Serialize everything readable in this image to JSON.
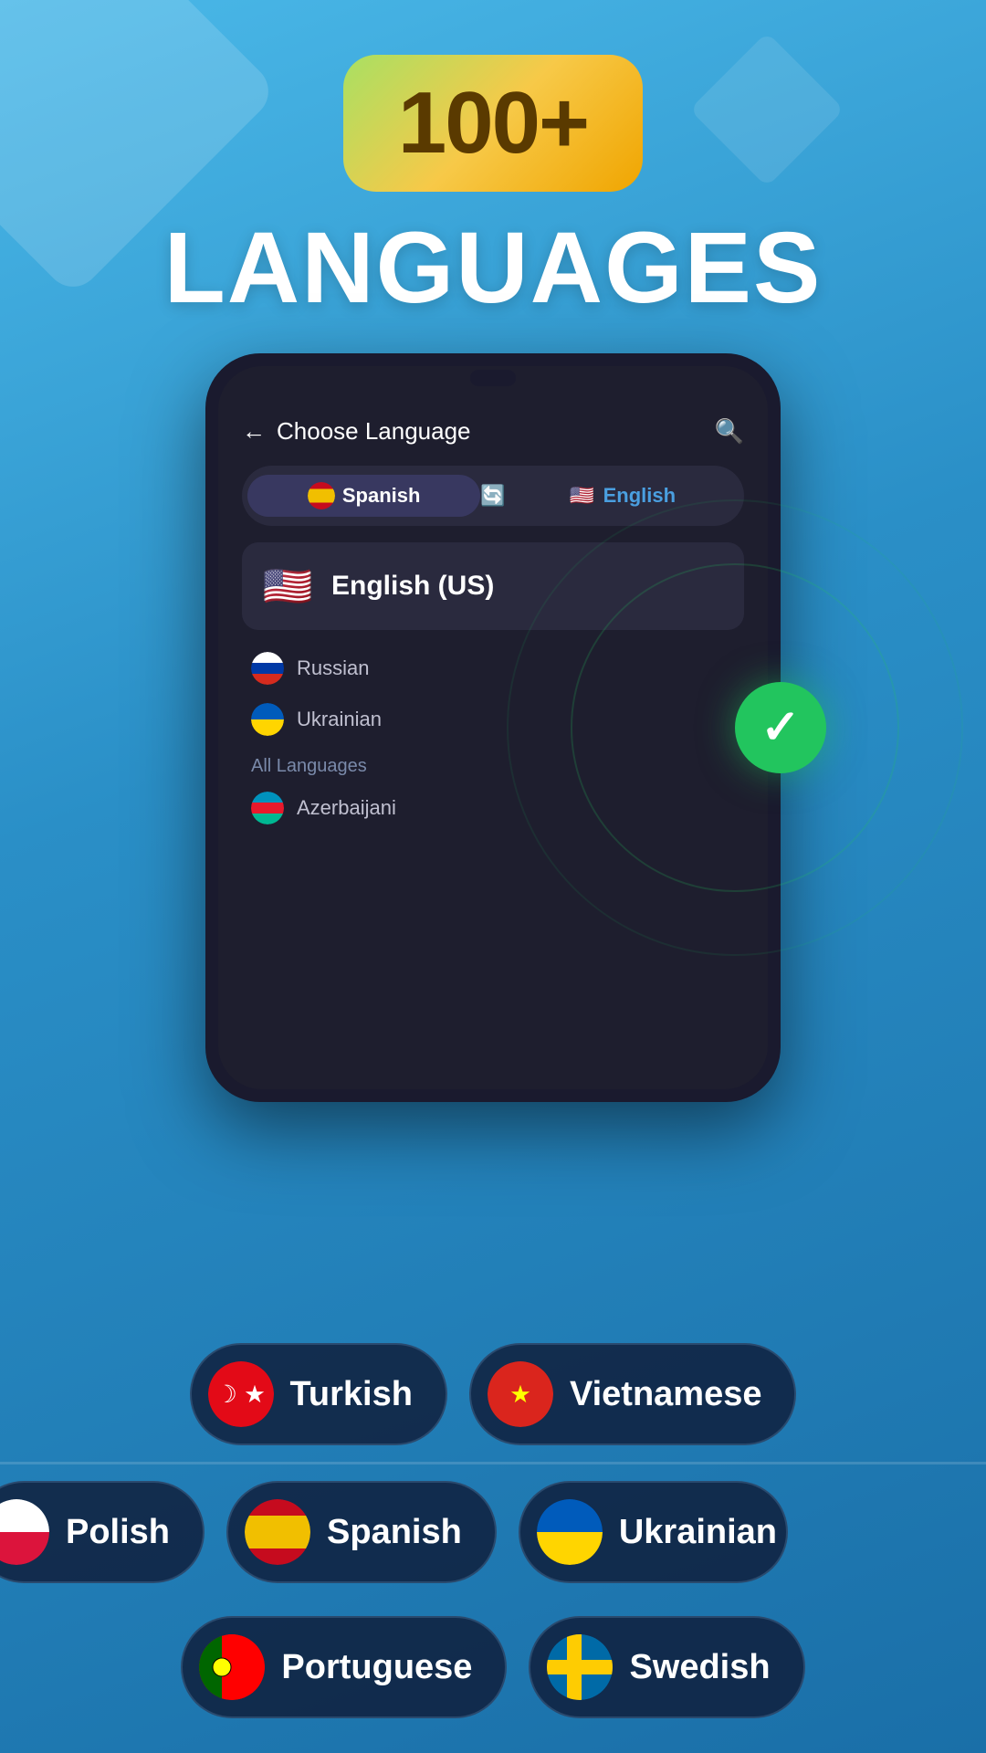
{
  "header": {
    "badge": "100+",
    "title": "LANGUAGES"
  },
  "phone": {
    "screen_title": "Choose Language",
    "tabs": {
      "from_lang": "Spanish",
      "to_lang": "English"
    },
    "selected_language": "English (US)",
    "recent_languages": [
      {
        "name": "Russian",
        "flag": "russia"
      },
      {
        "name": "Ukrainian",
        "flag": "ukraine"
      }
    ],
    "all_languages_label": "All Languages",
    "all_languages_list": [
      {
        "name": "Azerbaijani",
        "flag": "azerbaijan"
      }
    ]
  },
  "pills_row1": [
    {
      "name": "Turkish",
      "flag": "turkey"
    },
    {
      "name": "Vietnamese",
      "flag": "vietnam"
    }
  ],
  "pills_row2": [
    {
      "name": "Polish",
      "flag": "poland"
    },
    {
      "name": "Spanish",
      "flag": "spain"
    },
    {
      "name": "Ukrainian",
      "flag": "ukraine"
    }
  ],
  "pills_row3": [
    {
      "name": "Portuguese",
      "flag": "portugal"
    },
    {
      "name": "Swedish",
      "flag": "sweden"
    }
  ]
}
